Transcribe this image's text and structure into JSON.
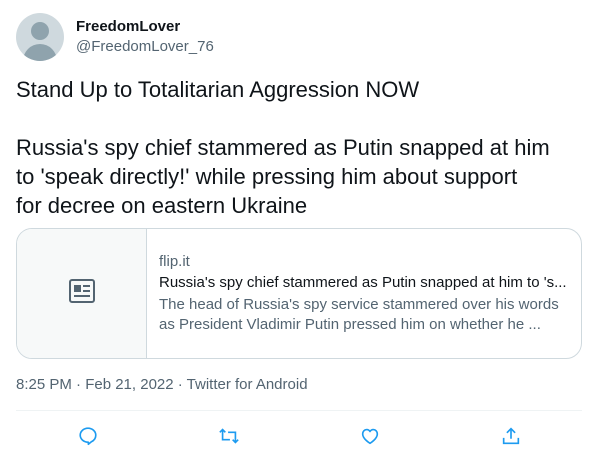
{
  "user": {
    "display_name": "FreedomLover",
    "handle": "@FreedomLover_76",
    "avatar_icon": "default-avatar-icon"
  },
  "tweet": {
    "headline": "Stand Up to Totalitarian Aggression NOW",
    "body_line1": "Russia's spy chief stammered as Putin snapped at him",
    "body_line2": "to 'speak directly!' while pressing him about support",
    "body_line3": "for decree on eastern Ukraine"
  },
  "card": {
    "icon": "news-article-icon",
    "domain": "flip.it",
    "title": "Russia's spy chief stammered as Putin snapped at him to 's...",
    "description_line1": "The head of Russia's spy service stammered over his words",
    "description_line2": "as President Vladimir Putin pressed him on whether he ..."
  },
  "meta": {
    "text": "8:25 PM · Feb 21, 2022 · Twitter for Android"
  },
  "actions": [
    "reply-icon",
    "retweet-icon",
    "like-icon",
    "share-icon"
  ],
  "colors": {
    "text_primary": "#0f1419",
    "text_secondary": "#536471",
    "border": "#cfd9de",
    "icon": "#1d9bf0"
  }
}
